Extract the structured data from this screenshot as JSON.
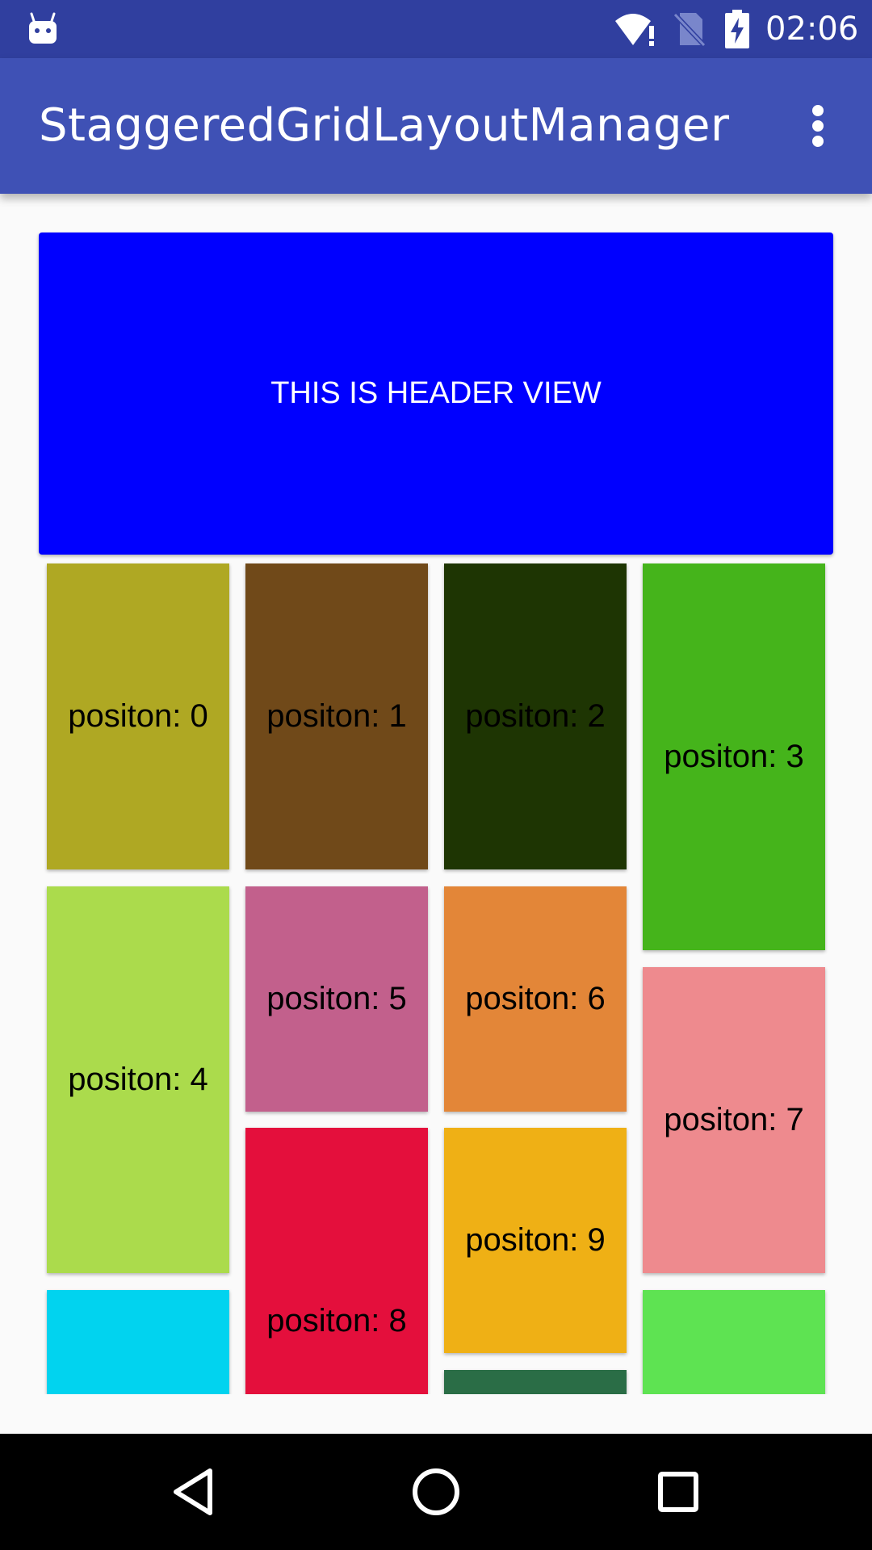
{
  "status_bar": {
    "time": "02:06",
    "icons": [
      "android-debug-icon",
      "wifi-alert-icon",
      "no-sim-icon",
      "battery-charging-icon"
    ]
  },
  "app_bar": {
    "title": "StaggeredGridLayoutManager",
    "menu_icon": "overflow-menu-icon"
  },
  "header_view": {
    "label": "THIS IS HEADER VIEW",
    "color": "#0000ff"
  },
  "grid": {
    "items": [
      {
        "label": "positon: 0",
        "color": "#afa823"
      },
      {
        "label": "positon: 1",
        "color": "#704919"
      },
      {
        "label": "positon: 2",
        "color": "#1e3503"
      },
      {
        "label": "positon: 3",
        "color": "#45b41b"
      },
      {
        "label": "positon: 4",
        "color": "#abdb4c"
      },
      {
        "label": "positon: 5",
        "color": "#c2608c"
      },
      {
        "label": "positon: 6",
        "color": "#e38638"
      },
      {
        "label": "positon: 7",
        "color": "#ee8a8e"
      },
      {
        "label": "positon: 8",
        "color": "#e40f3c"
      },
      {
        "label": "positon: 9",
        "color": "#efb015"
      },
      {
        "label": "",
        "color": "#01d3ef"
      },
      {
        "label": "",
        "color": "#2a6d46"
      },
      {
        "label": "",
        "color": "#5ee352"
      }
    ]
  },
  "nav_bar": {
    "buttons": [
      "back-icon",
      "home-icon",
      "recents-icon"
    ]
  }
}
